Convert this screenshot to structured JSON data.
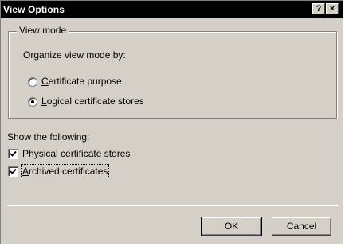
{
  "window": {
    "title": "View Options",
    "help_glyph": "?",
    "close_glyph": "×"
  },
  "view_mode": {
    "legend": "View mode",
    "prompt": "Organize view mode by:",
    "options": [
      {
        "accel": "C",
        "rest": "ertificate purpose",
        "selected": false
      },
      {
        "accel": "L",
        "rest": "ogical certificate stores",
        "selected": true
      }
    ]
  },
  "show": {
    "heading": "Show the following:",
    "items": [
      {
        "accel": "P",
        "rest": "hysical certificate stores",
        "checked": true
      },
      {
        "accel": "A",
        "rest": "rchived certificates",
        "checked": true
      }
    ]
  },
  "buttons": {
    "ok": "OK",
    "cancel": "Cancel"
  }
}
